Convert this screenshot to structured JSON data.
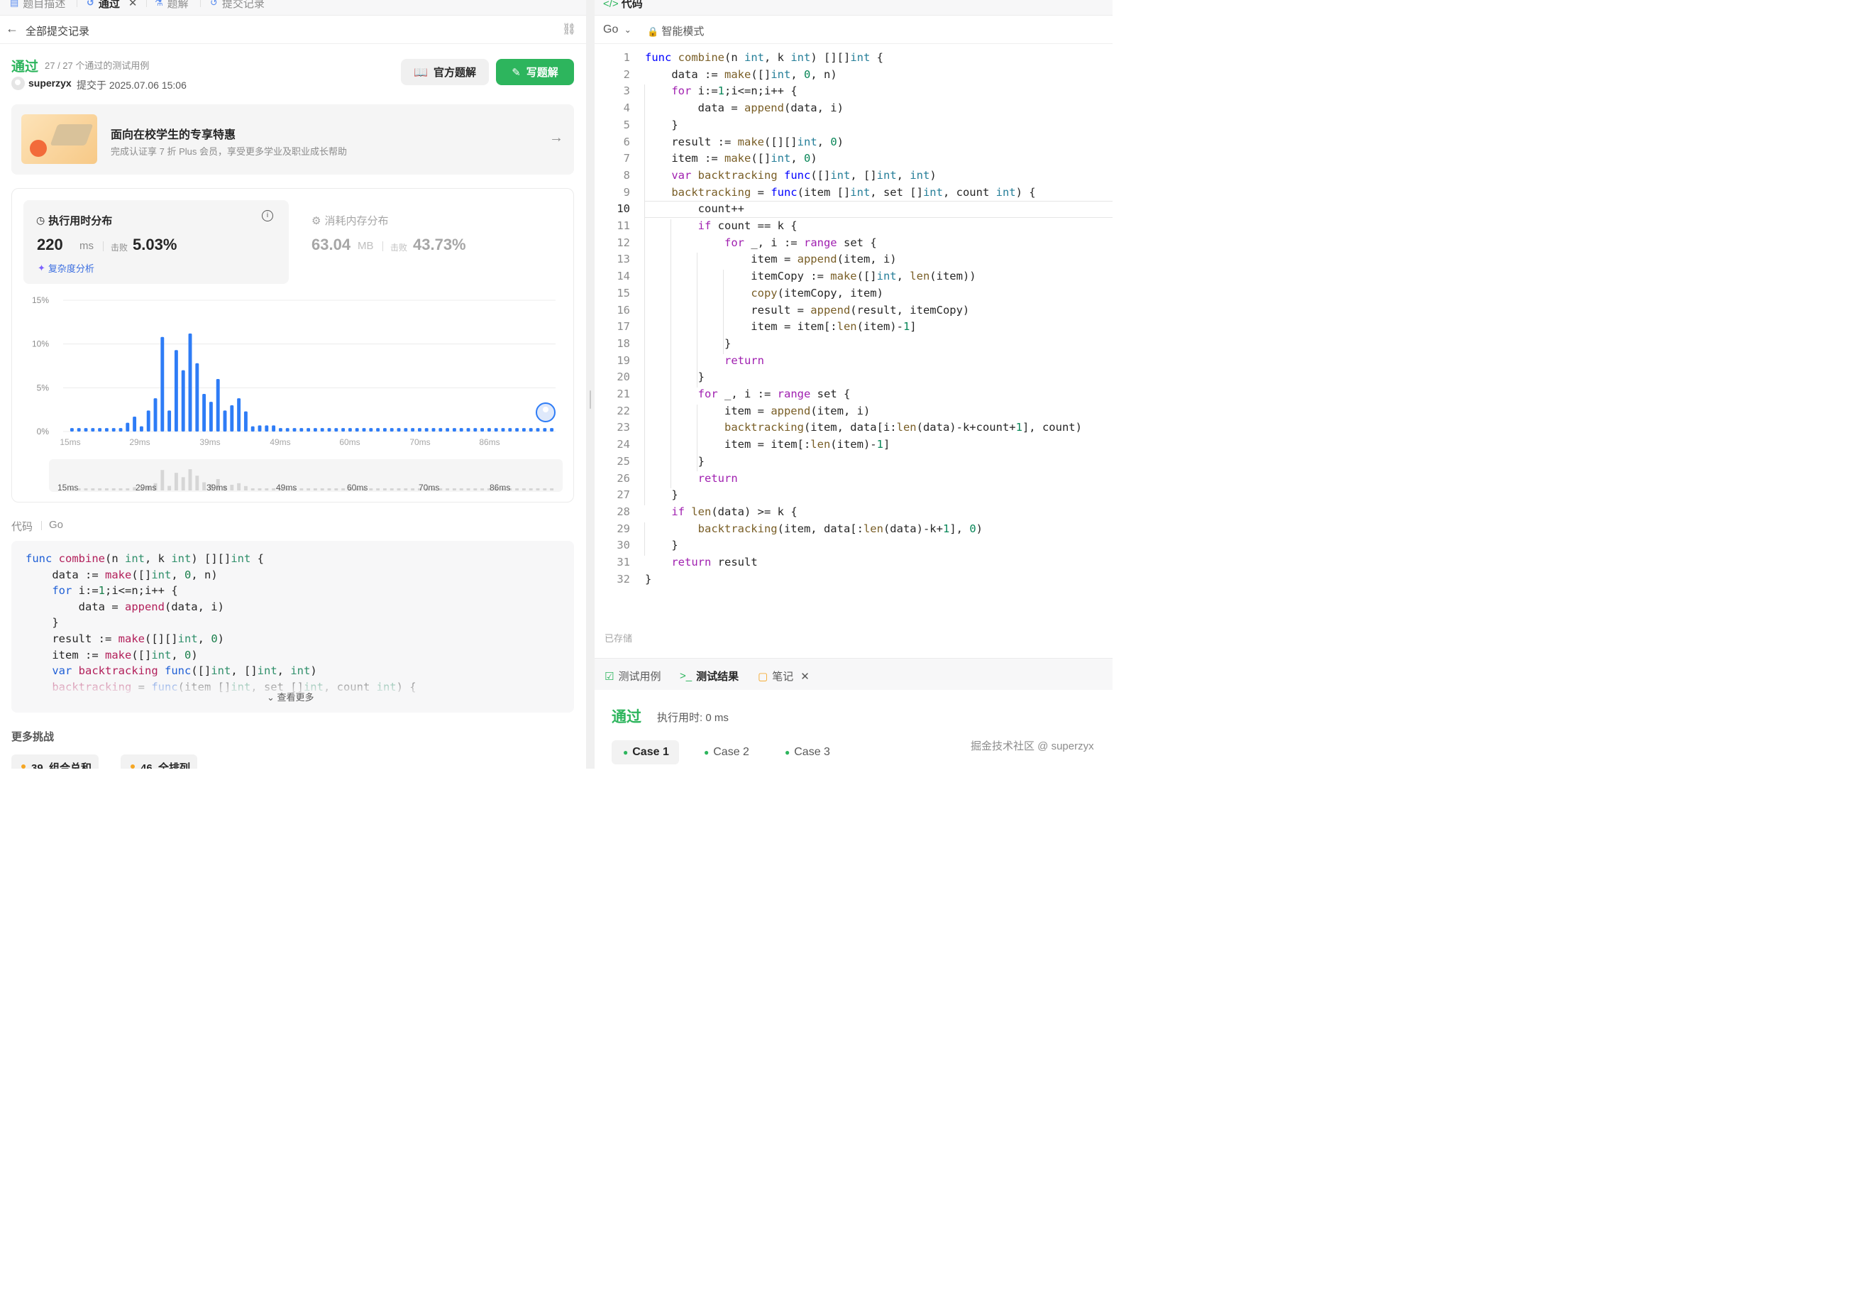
{
  "left": {
    "tabs": [
      {
        "label": "题目描述",
        "icon": "document-icon"
      },
      {
        "label": "通过",
        "icon": "history-icon"
      },
      {
        "label": "题解",
        "icon": "flask-icon"
      },
      {
        "label": "提交记录",
        "icon": "history-icon"
      }
    ],
    "tab_close": "✕",
    "back_label": "全部提交记录",
    "status": "通过",
    "tests": "27 / 27 个通过的测试用例",
    "submitter": "superzyx",
    "submit_time": "提交于 2025.07.06 15:06",
    "official_btn": "官方题解",
    "write_btn": "写题解",
    "promo": {
      "title": "面向在校学生的专享特惠",
      "desc": "完成认证享 7 折 Plus 会员，享受更多学业及职业成长帮助"
    },
    "runtime": {
      "heading": "执行用时分布",
      "value": "220",
      "unit": "ms",
      "beat_label": "击败",
      "pct": "5.03%",
      "complexity": "复杂度分析"
    },
    "memory": {
      "heading": "消耗内存分布",
      "value": "63.04",
      "unit": "MB",
      "beat_label": "击败",
      "pct": "43.73%"
    },
    "code_title": "代码",
    "code_lang": "Go",
    "see_more": "查看更多",
    "more_challenges": "更多挑战",
    "chips": [
      "39. 组合总和",
      "46. 全排列"
    ]
  },
  "chart_data": {
    "type": "bar",
    "yticks": [
      "15%",
      "10%",
      "5%",
      "0%"
    ],
    "ylim": [
      0,
      15
    ],
    "xticks": [
      "15ms",
      "29ms",
      "39ms",
      "49ms",
      "60ms",
      "70ms",
      "86ms"
    ],
    "values": [
      0.4,
      0.4,
      0.4,
      0.4,
      0.4,
      0.4,
      0.4,
      0.4,
      1.0,
      1.7,
      0.6,
      2.4,
      3.8,
      10.8,
      2.4,
      9.3,
      7.0,
      11.2,
      7.8,
      4.3,
      3.4,
      6.0,
      2.4,
      3.0,
      3.8,
      2.3,
      0.6,
      0.7,
      0.7,
      0.7,
      0.4,
      0.4,
      0.4,
      0.4,
      0.4,
      0.4,
      0.4,
      0.4,
      0.4,
      0.4,
      0.4,
      0.4,
      0.4,
      0.4,
      0.4,
      0.4,
      0.4,
      0.4,
      0.4,
      0.4,
      0.4,
      0.4,
      0.4,
      0.4,
      0.4,
      0.4,
      0.4,
      0.4,
      0.4,
      0.4,
      0.4,
      0.4,
      0.4,
      0.4,
      0.4,
      0.4,
      0.4,
      0.4,
      0.4,
      0.4
    ],
    "bar_color": "#2e7cf6",
    "grid": true
  },
  "left_code": [
    "func combine(n int, k int) [][]int {",
    "    data := make([]int, 0, n)",
    "    for i:=1;i<=n;i++ {",
    "        data = append(data, i)",
    "    }",
    "    result := make([][]int, 0)",
    "    item := make([]int, 0)",
    "    var backtracking func([]int, []int, int)",
    "    backtracking = func(item []int, set []int, count int) {"
  ],
  "editor": {
    "tab": "代码",
    "lang": "Go",
    "mode": "智能模式",
    "current_line": 10,
    "lines": [
      "func combine(n int, k int) [][]int {",
      "    data := make([]int, 0, n)",
      "    for i:=1;i<=n;i++ {",
      "        data = append(data, i)",
      "    }",
      "    result := make([][]int, 0)",
      "    item := make([]int, 0)",
      "    var backtracking func([]int, []int, int)",
      "    backtracking = func(item []int, set []int, count int) {",
      "        count++",
      "        if count == k {",
      "            for _, i := range set {",
      "                item = append(item, i)",
      "                itemCopy := make([]int, len(item))",
      "                copy(itemCopy, item)",
      "                result = append(result, itemCopy)",
      "                item = item[:len(item)-1]",
      "            }",
      "            return",
      "        }",
      "        for _, i := range set {",
      "            item = append(item, i)",
      "            backtracking(item, data[i:len(data)-k+count+1], count)",
      "            item = item[:len(item)-1]",
      "        }",
      "        return",
      "    }",
      "    if len(data) >= k {",
      "        backtracking(item, data[:len(data)-k+1], 0)",
      "    }",
      "    return result",
      "}"
    ],
    "saved": "已存储"
  },
  "bottom": {
    "tabs": [
      "测试用例",
      "测试结果",
      "笔记"
    ],
    "status": "通过",
    "runtime": "执行用时: 0 ms",
    "cases": [
      "Case 1",
      "Case 2",
      "Case 3"
    ],
    "watermark": "掘金技术社区 @ superzyx"
  }
}
